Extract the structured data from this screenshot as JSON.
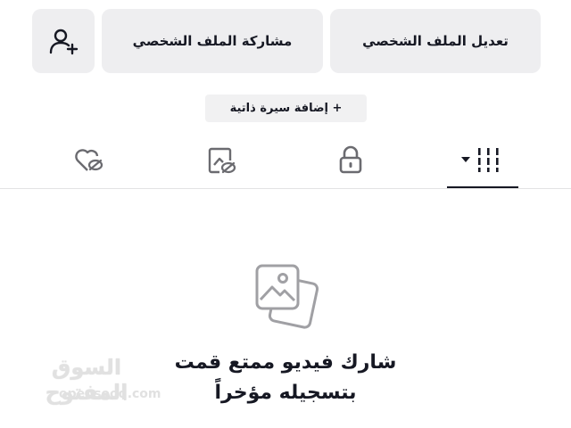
{
  "buttons": {
    "edit_profile": "تعديل الملف الشخصي",
    "share_profile": "مشاركة الملف الشخصي"
  },
  "add_bio": "+ إضافة سيرة ذاتية",
  "tabs": [
    {
      "name": "videos",
      "icon": "grid-columns-icon",
      "selected": true
    },
    {
      "name": "private",
      "icon": "lock-icon"
    },
    {
      "name": "reposts",
      "icon": "image-hidden-icon"
    },
    {
      "name": "liked",
      "icon": "heart-hidden-icon"
    }
  ],
  "empty_state": {
    "line1": "شارك فيديو ممتع قمت",
    "line2": "بتسجيله مؤخراً",
    "icon": "photos-icon"
  },
  "watermark": {
    "arabic": "السوق المفتوح",
    "latin": "opensooq.com"
  },
  "colors": {
    "button_bg": "#eeeef0",
    "text": "#161823",
    "icon_gray": "#a0a0a4",
    "divider": "#e3e3e4"
  }
}
